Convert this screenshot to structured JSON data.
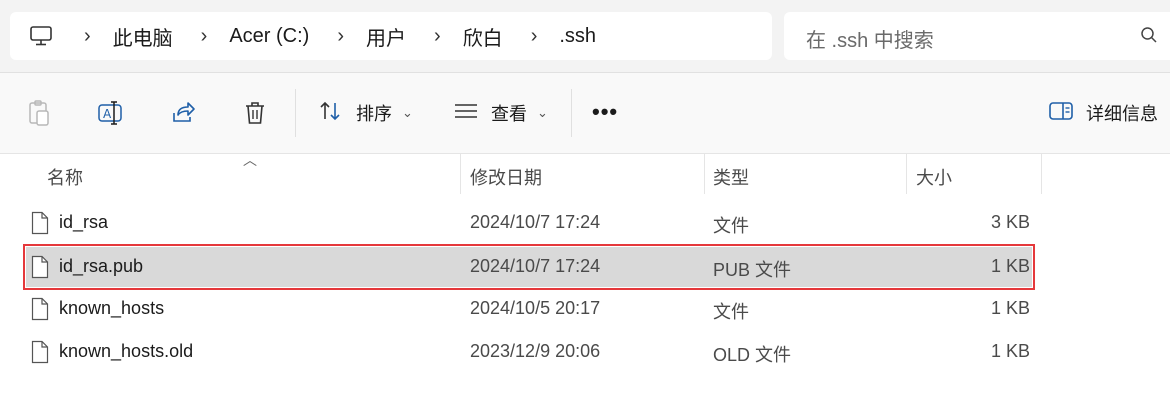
{
  "address": {
    "breadcrumbs": [
      "此电脑",
      "Acer (C:)",
      "用户",
      "欣白",
      ".ssh"
    ]
  },
  "search": {
    "placeholder": "在 .ssh 中搜索"
  },
  "toolbar": {
    "sort_label": "排序",
    "view_label": "查看",
    "more_label": "•••",
    "details_label": "详细信息"
  },
  "columns": {
    "name": "名称",
    "date": "修改日期",
    "type": "类型",
    "size": "大小"
  },
  "files": [
    {
      "name": "id_rsa",
      "date": "2024/10/7 17:24",
      "type": "文件",
      "size": "3 KB"
    },
    {
      "name": "id_rsa.pub",
      "date": "2024/10/7 17:24",
      "type": "PUB 文件",
      "size": "1 KB"
    },
    {
      "name": "known_hosts",
      "date": "2024/10/5 20:17",
      "type": "文件",
      "size": "1 KB"
    },
    {
      "name": "known_hosts.old",
      "date": "2023/12/9 20:06",
      "type": "OLD 文件",
      "size": "1 KB"
    }
  ],
  "colors": {
    "selection": "#d9d9d9",
    "highlight_border": "#e5383b"
  },
  "icons": [
    "computer-icon",
    "search-icon",
    "paste-icon",
    "rename-icon",
    "share-icon",
    "delete-icon",
    "sort-icon",
    "view-icon",
    "details-pane-icon",
    "file-icon"
  ]
}
